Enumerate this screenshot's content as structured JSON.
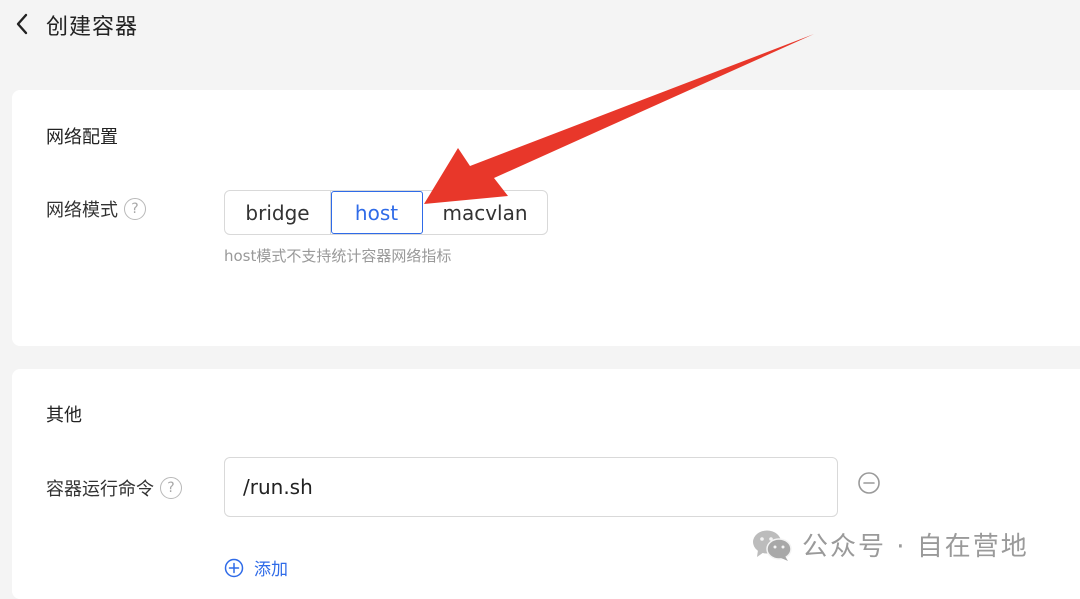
{
  "header": {
    "title": "创建容器"
  },
  "network_section": {
    "title": "网络配置",
    "mode_label": "网络模式",
    "help_glyph": "?",
    "modes": [
      {
        "label": "bridge",
        "active": false
      },
      {
        "label": "host",
        "active": true
      },
      {
        "label": "macvlan",
        "active": false
      }
    ],
    "hint": "host模式不支持统计容器网络指标"
  },
  "other_section": {
    "title": "其他",
    "command_label": "容器运行命令",
    "help_glyph": "?",
    "command_value": "/run.sh",
    "add_label": "添加"
  },
  "watermark": {
    "text": "公众号 · 自在营地"
  },
  "colors": {
    "accent": "#2f6be8",
    "arrow": "#e8372a",
    "background": "#f4f4f4",
    "card": "#ffffff"
  }
}
